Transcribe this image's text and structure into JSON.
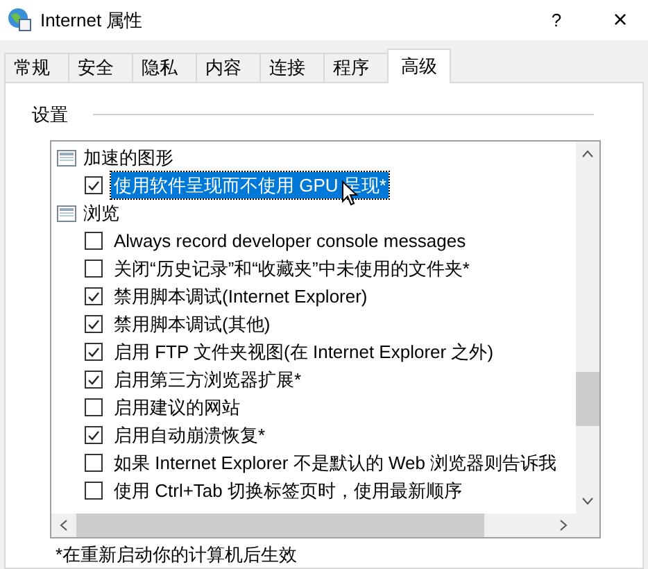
{
  "window": {
    "title": "Internet 属性",
    "help": "?",
    "close": "×"
  },
  "tabs": [
    {
      "label": "常规",
      "selected": false
    },
    {
      "label": "安全",
      "selected": false
    },
    {
      "label": "隐私",
      "selected": false
    },
    {
      "label": "内容",
      "selected": false
    },
    {
      "label": "连接",
      "selected": false
    },
    {
      "label": "程序",
      "selected": false
    },
    {
      "label": "高级",
      "selected": true
    }
  ],
  "settings": {
    "title": "设置",
    "tree": [
      {
        "label": "加速的图形",
        "children": [
          {
            "label": "使用软件呈现而不使用 GPU 呈现*",
            "checked": true,
            "selected": true
          }
        ]
      },
      {
        "label": "浏览",
        "children": [
          {
            "label": "Always record developer console messages",
            "checked": false,
            "selected": false
          },
          {
            "label": "关闭“历史记录”和“收藏夹”中未使用的文件夹*",
            "checked": false,
            "selected": false
          },
          {
            "label": "禁用脚本调试(Internet Explorer)",
            "checked": true,
            "selected": false
          },
          {
            "label": "禁用脚本调试(其他)",
            "checked": true,
            "selected": false
          },
          {
            "label": "启用 FTP 文件夹视图(在 Internet Explorer 之外)",
            "checked": true,
            "selected": false
          },
          {
            "label": "启用第三方浏览器扩展*",
            "checked": true,
            "selected": false
          },
          {
            "label": "启用建议的网站",
            "checked": false,
            "selected": false
          },
          {
            "label": "启用自动崩溃恢复*",
            "checked": true,
            "selected": false
          },
          {
            "label": "如果 Internet Explorer 不是默认的 Web 浏览器则告诉我",
            "checked": false,
            "selected": false
          },
          {
            "label": "使用 Ctrl+Tab 切换标签页时，使用最新顺序",
            "checked": false,
            "selected": false
          }
        ]
      }
    ],
    "footnote": "*在重新启动你的计算机后生效"
  }
}
